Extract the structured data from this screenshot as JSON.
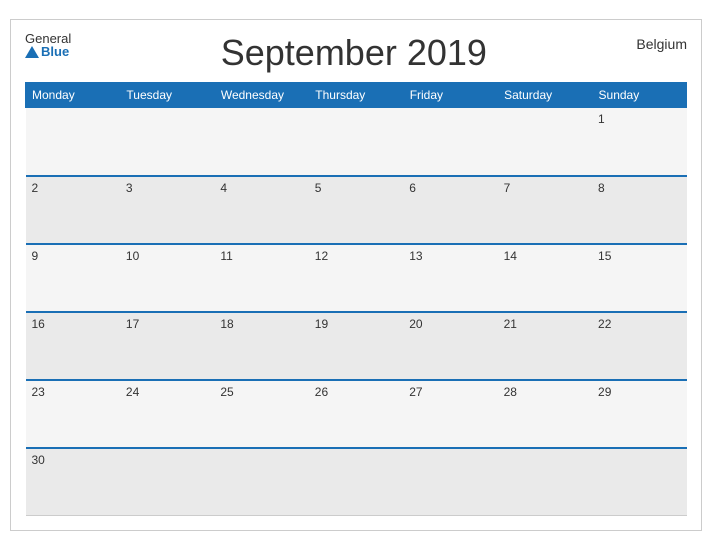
{
  "logo": {
    "general": "General",
    "blue": "Blue"
  },
  "header": {
    "title": "September 2019",
    "country": "Belgium"
  },
  "days_of_week": [
    "Monday",
    "Tuesday",
    "Wednesday",
    "Thursday",
    "Friday",
    "Saturday",
    "Sunday"
  ],
  "weeks": [
    [
      null,
      null,
      null,
      null,
      null,
      null,
      1
    ],
    [
      2,
      3,
      4,
      5,
      6,
      7,
      8
    ],
    [
      9,
      10,
      11,
      12,
      13,
      14,
      15
    ],
    [
      16,
      17,
      18,
      19,
      20,
      21,
      22
    ],
    [
      23,
      24,
      25,
      26,
      27,
      28,
      29
    ],
    [
      30,
      null,
      null,
      null,
      null,
      null,
      null
    ]
  ]
}
